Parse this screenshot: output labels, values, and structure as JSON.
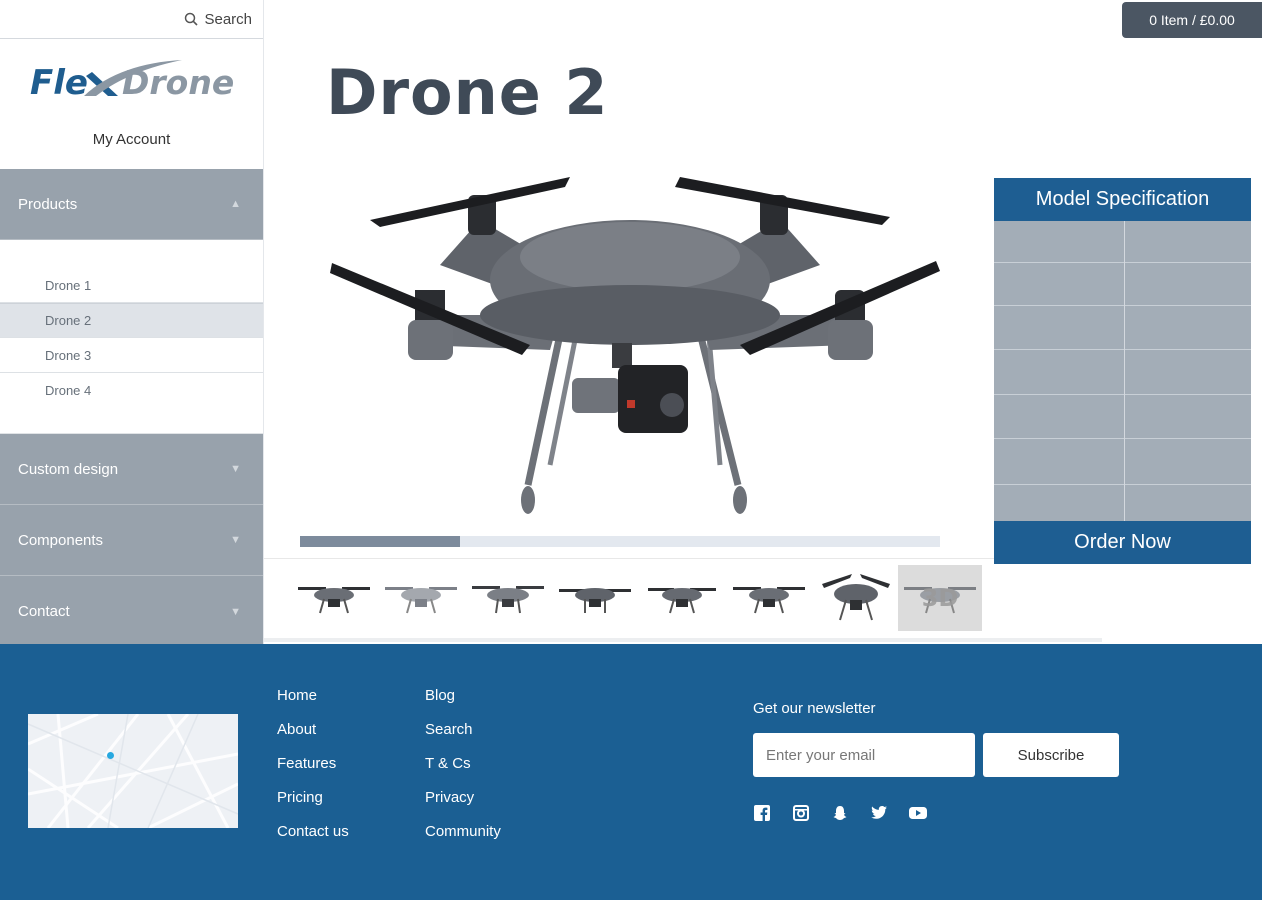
{
  "search": {
    "label": "Search",
    "icon": "search-icon"
  },
  "logo": {
    "text_part1": "Fle",
    "text_part2": "Drone",
    "mark": "x-swoosh-icon"
  },
  "account": {
    "label": "My Account"
  },
  "sidebar": {
    "products_label": "Products",
    "products_items": [
      "Drone 1",
      "Drone 2",
      "Drone 3",
      "Drone 4"
    ],
    "active_item": "Drone 2",
    "custom_design_label": "Custom design",
    "components_label": "Components",
    "contact_label": "Contact"
  },
  "cart": {
    "label": "0 Item / £0.00"
  },
  "product": {
    "title": "Drone 2",
    "image_progress_percent": 25,
    "thumbnail_count": 8
  },
  "spec": {
    "header": "Model Specification",
    "order_label": "Order Now",
    "rows": 7,
    "columns": 2
  },
  "footer": {
    "links_col1": [
      "Home",
      "About",
      "Features",
      "Pricing",
      "Contact us"
    ],
    "links_col2": [
      "Blog",
      "Search",
      "T & Cs",
      "Privacy",
      "Community"
    ],
    "newsletter_label": "Get our newsletter",
    "email_placeholder": "Enter your email",
    "subscribe_label": "Subscribe",
    "socials": [
      "facebook-icon",
      "instagram-icon",
      "snapchat-icon",
      "twitter-icon",
      "youtube-icon"
    ]
  },
  "colors": {
    "footer_bg": "#1b5f93",
    "spec_header": "#1e5e92",
    "sidebar_section": "#98a2ac",
    "cart_bg": "#4b5663"
  }
}
